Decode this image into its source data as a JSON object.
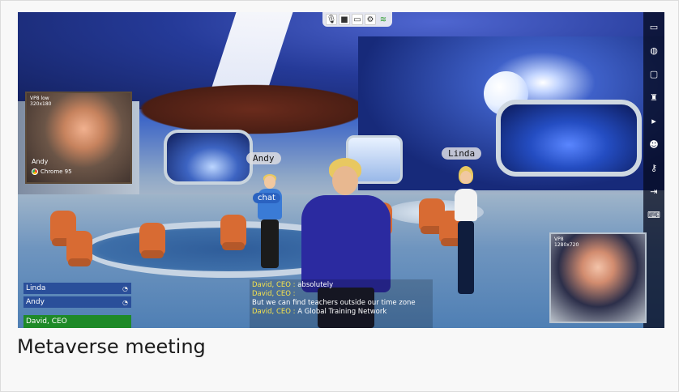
{
  "scene": {
    "avatars": {
      "andy": {
        "name": "Andy",
        "chat_label": "chat"
      },
      "linda": {
        "name": "Linda"
      }
    }
  },
  "video_tiles": {
    "andy": {
      "codec": "VP8 low",
      "resolution": "320x180",
      "name": "Andy",
      "browser": "Chrome 95"
    },
    "linda": {
      "codec": "VP8",
      "resolution": "1280x720"
    }
  },
  "participants": [
    {
      "name": "Linda",
      "status_color": "#2a4f9a"
    },
    {
      "name": "Andy",
      "status_color": "#2a4f9a"
    },
    {
      "name": "David, CEO",
      "status_color": "#1e8a28"
    }
  ],
  "chat": [
    {
      "who": "David, CEO :",
      "text": " absolutely"
    },
    {
      "who": "David, CEO :",
      "text": ""
    },
    {
      "who": "",
      "text": " But we can find teachers outside our time zone"
    },
    {
      "who": "David, CEO :",
      "text": " A Global Training Network"
    }
  ],
  "toolbar_top": [
    {
      "icon": "microphone-icon"
    },
    {
      "icon": "camera-icon"
    },
    {
      "icon": "screen-icon"
    },
    {
      "icon": "settings-icon"
    },
    {
      "icon": "wifi-icon"
    }
  ],
  "toolbar_right": [
    {
      "icon": "tag-icon"
    },
    {
      "icon": "globe-icon"
    },
    {
      "icon": "screen-share-icon"
    },
    {
      "icon": "avatar-outfit-icon"
    },
    {
      "icon": "video-icon"
    },
    {
      "icon": "person-speak-icon"
    },
    {
      "icon": "key-icon"
    },
    {
      "icon": "exit-icon"
    },
    {
      "icon": "keyboard-icon"
    }
  ],
  "caption": "Metaverse meeting"
}
